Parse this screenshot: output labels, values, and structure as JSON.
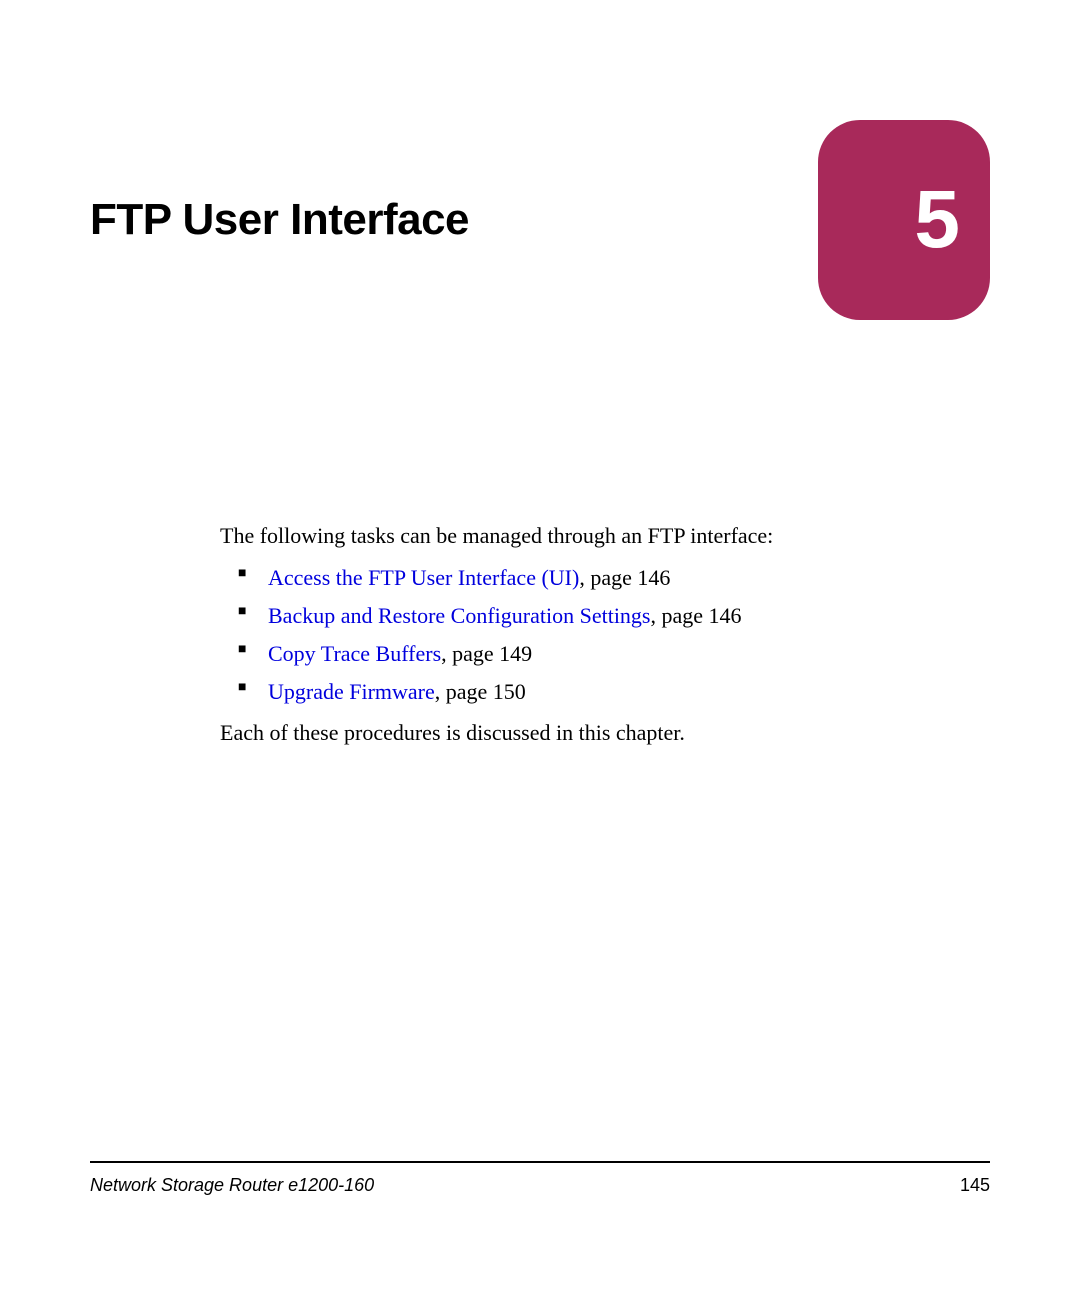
{
  "chapter": {
    "title": "FTP User Interface",
    "number": "5"
  },
  "content": {
    "intro": "The following tasks can be managed through an FTP interface:",
    "bullets": [
      {
        "link": "Access the FTP User Interface (UI)",
        "suffix": ", page 146"
      },
      {
        "link": "Backup and Restore Configuration Settings",
        "suffix": ", page 146"
      },
      {
        "link": "Copy Trace Buffers",
        "suffix": ", page 149"
      },
      {
        "link": "Upgrade Firmware",
        "suffix": ", page 150"
      }
    ],
    "closing": "Each of these procedures is discussed in this chapter."
  },
  "footer": {
    "left": "Network Storage Router e1200-160",
    "right": "145"
  }
}
